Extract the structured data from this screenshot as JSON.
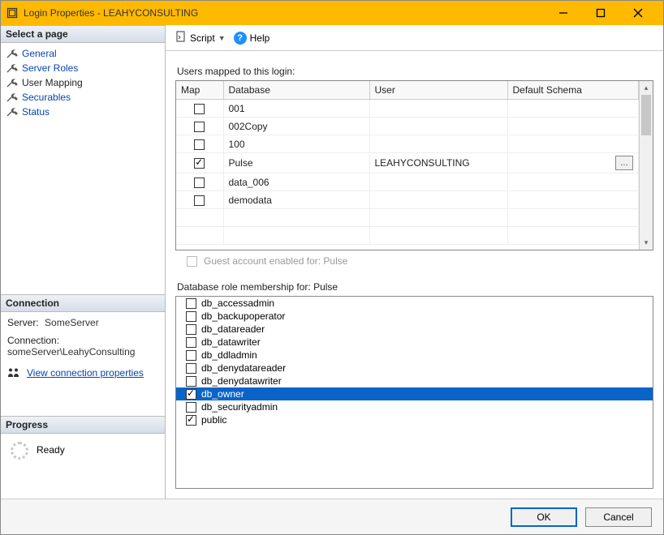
{
  "window": {
    "title": "Login Properties - LEAHYCONSULTING"
  },
  "sidebar": {
    "header_pages": "Select a page",
    "pages": [
      {
        "label": "General"
      },
      {
        "label": "Server Roles"
      },
      {
        "label": "User Mapping"
      },
      {
        "label": "Securables"
      },
      {
        "label": "Status"
      }
    ],
    "header_connection": "Connection",
    "server_label": "Server:",
    "server_value": "SomeServer",
    "connection_label": "Connection:",
    "connection_value": "someServer\\LeahyConsulting",
    "view_props_link": "View connection properties",
    "header_progress": "Progress",
    "progress_status": "Ready"
  },
  "toolbar": {
    "script_label": "Script",
    "help_label": "Help"
  },
  "usermap": {
    "label": "Users mapped to this login:",
    "cols": {
      "map": "Map",
      "database": "Database",
      "user": "User",
      "schema": "Default Schema"
    },
    "rows": [
      {
        "checked": false,
        "database": "001",
        "user": "",
        "schema": ""
      },
      {
        "checked": false,
        "database": "002Copy",
        "user": "",
        "schema": ""
      },
      {
        "checked": false,
        "database": "100",
        "user": "",
        "schema": ""
      },
      {
        "checked": true,
        "database": "Pulse",
        "user": "LEAHYCONSULTING",
        "schema": ""
      },
      {
        "checked": false,
        "database": "data_006",
        "user": "",
        "schema": ""
      },
      {
        "checked": false,
        "database": "demodata",
        "user": "",
        "schema": ""
      }
    ]
  },
  "guest": {
    "label": "Guest account enabled for: Pulse"
  },
  "roles": {
    "label": "Database role membership for: Pulse",
    "items": [
      {
        "name": "db_accessadmin",
        "checked": false,
        "selected": false
      },
      {
        "name": "db_backupoperator",
        "checked": false,
        "selected": false
      },
      {
        "name": "db_datareader",
        "checked": false,
        "selected": false
      },
      {
        "name": "db_datawriter",
        "checked": false,
        "selected": false
      },
      {
        "name": "db_ddladmin",
        "checked": false,
        "selected": false
      },
      {
        "name": "db_denydatareader",
        "checked": false,
        "selected": false
      },
      {
        "name": "db_denydatawriter",
        "checked": false,
        "selected": false
      },
      {
        "name": "db_owner",
        "checked": true,
        "selected": true
      },
      {
        "name": "db_securityadmin",
        "checked": false,
        "selected": false
      },
      {
        "name": "public",
        "checked": true,
        "selected": false
      }
    ]
  },
  "footer": {
    "ok": "OK",
    "cancel": "Cancel"
  }
}
